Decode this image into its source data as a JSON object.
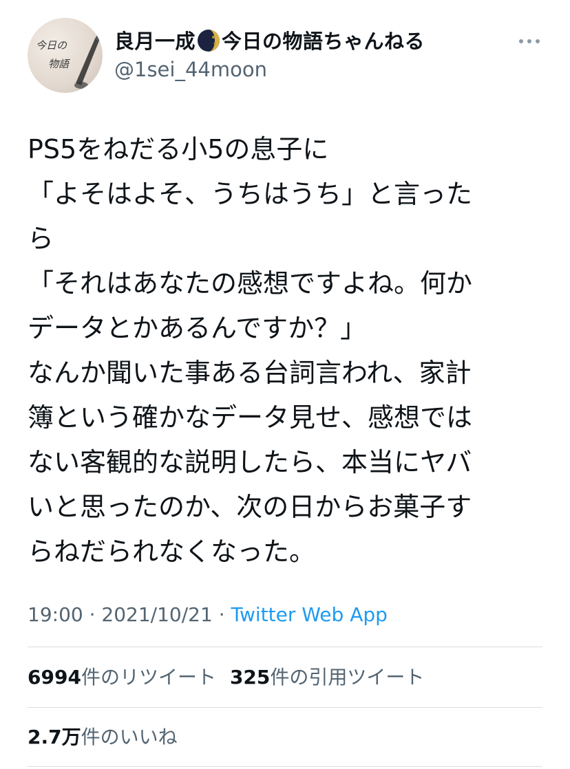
{
  "author": {
    "name_part1": "良月一成",
    "name_part2": "今日の物語ちゃんねる",
    "handle": "@1sei_44moon",
    "avatar_text": [
      "今日の",
      "物語"
    ]
  },
  "icons": {
    "moon": "moon-icon",
    "more": "more-horizontal-icon",
    "avatar": "avatar-image"
  },
  "tweet": {
    "lines": [
      "PS5をねだる小5の息子に",
      "「よそはよそ、うちはうち」と言った",
      "ら",
      "「それはあなたの感想ですよね。何か",
      "データとかあるんですか？」",
      "なんか聞いた事ある台詞言われ、家計",
      "簿という確かなデータ見せ、感想では",
      "ない客観的な説明したら、本当にヤバ",
      "いと思ったのか、次の日からお菓子す",
      "らねだられなくなった。"
    ]
  },
  "meta": {
    "time": "19:00",
    "separator": " · ",
    "date": "2021/10/21",
    "source": "Twitter Web App"
  },
  "stats": {
    "retweets_count": "6994",
    "retweets_label": "件のリツイート",
    "quotes_count": "325",
    "quotes_label": "件の引用ツイート",
    "likes_count": "2.7万",
    "likes_label": "件のいいね"
  },
  "colors": {
    "text": "#0f1419",
    "secondary": "#536471",
    "link": "#1d9bf0",
    "divider": "#d8dde1"
  }
}
